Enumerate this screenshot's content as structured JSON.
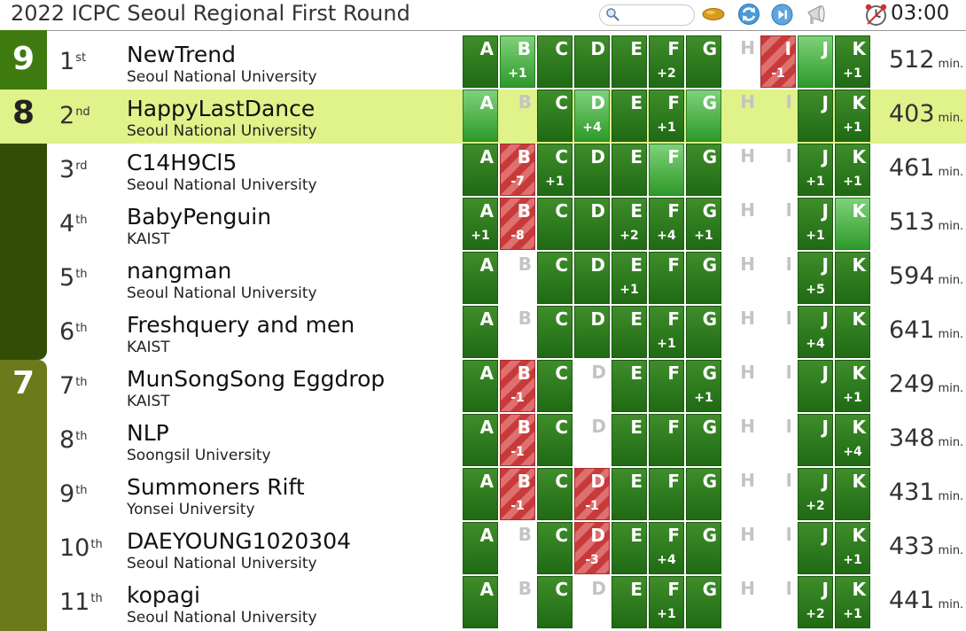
{
  "header": {
    "title": "2022 ICPC Seoul Regional First Round",
    "timer": "03:00",
    "search": {
      "placeholder": "",
      "value": ""
    },
    "icons": [
      "search-icon",
      "ball-icon",
      "refresh-icon",
      "play-icon",
      "megaphone-icon",
      "clock-icon"
    ]
  },
  "colors": {
    "solved": "#2f7d1f",
    "first_solve": "#59b851",
    "failed": "#cc4444",
    "highlight_row": "#e0f28a",
    "band_9": "#3f7a10",
    "band_8": "#e0f28a",
    "band_high": "#344d06",
    "band_7": "#6b7a1a"
  },
  "bands": [
    {
      "label": "9",
      "style": "band_9"
    },
    {
      "label": "8",
      "style": "band_8"
    },
    {
      "label": "",
      "style": "band_high"
    },
    {
      "label": "7",
      "style": "band_7"
    }
  ],
  "problems": [
    "A",
    "B",
    "C",
    "D",
    "E",
    "F",
    "G",
    "H",
    "I",
    "J",
    "K"
  ],
  "score_unit": "min.",
  "teams": [
    {
      "rank": "1",
      "suffix": "st",
      "name": "NewTrend",
      "university": "Seoul National University",
      "score": "512",
      "highlight": false,
      "cells": [
        [
          "s",
          ""
        ],
        [
          "f1",
          "+1"
        ],
        [
          "s",
          ""
        ],
        [
          "s",
          ""
        ],
        [
          "s",
          ""
        ],
        [
          "s",
          "+2"
        ],
        [
          "s",
          ""
        ],
        [
          "e",
          ""
        ],
        [
          "x",
          "-1"
        ],
        [
          "f1",
          ""
        ],
        [
          "s",
          "+1"
        ]
      ]
    },
    {
      "rank": "2",
      "suffix": "nd",
      "name": "HappyLastDance",
      "university": "Seoul National University",
      "score": "403",
      "highlight": true,
      "cells": [
        [
          "f1",
          ""
        ],
        [
          "e",
          ""
        ],
        [
          "s",
          ""
        ],
        [
          "f1",
          "+4"
        ],
        [
          "s",
          ""
        ],
        [
          "s",
          "+1"
        ],
        [
          "f1",
          ""
        ],
        [
          "e",
          ""
        ],
        [
          "e",
          ""
        ],
        [
          "s",
          ""
        ],
        [
          "s",
          "+1"
        ]
      ]
    },
    {
      "rank": "3",
      "suffix": "rd",
      "name": "C14H9Cl5",
      "university": "Seoul National University",
      "score": "461",
      "highlight": false,
      "cells": [
        [
          "s",
          ""
        ],
        [
          "x",
          "-7"
        ],
        [
          "s",
          "+1"
        ],
        [
          "s",
          ""
        ],
        [
          "s",
          ""
        ],
        [
          "f1",
          ""
        ],
        [
          "s",
          ""
        ],
        [
          "e",
          ""
        ],
        [
          "e",
          ""
        ],
        [
          "s",
          "+1"
        ],
        [
          "s",
          "+1"
        ]
      ]
    },
    {
      "rank": "4",
      "suffix": "th",
      "name": "BabyPenguin",
      "university": "KAIST",
      "score": "513",
      "highlight": false,
      "cells": [
        [
          "s",
          "+1"
        ],
        [
          "x",
          "-8"
        ],
        [
          "s",
          ""
        ],
        [
          "s",
          ""
        ],
        [
          "s",
          "+2"
        ],
        [
          "s",
          "+4"
        ],
        [
          "s",
          "+1"
        ],
        [
          "e",
          ""
        ],
        [
          "e",
          ""
        ],
        [
          "s",
          "+1"
        ],
        [
          "f1",
          ""
        ]
      ]
    },
    {
      "rank": "5",
      "suffix": "th",
      "name": "nangman",
      "university": "Seoul National University",
      "score": "594",
      "highlight": false,
      "cells": [
        [
          "s",
          ""
        ],
        [
          "e",
          ""
        ],
        [
          "s",
          ""
        ],
        [
          "s",
          ""
        ],
        [
          "s",
          "+1"
        ],
        [
          "s",
          ""
        ],
        [
          "s",
          ""
        ],
        [
          "e",
          ""
        ],
        [
          "e",
          ""
        ],
        [
          "s",
          "+5"
        ],
        [
          "s",
          ""
        ]
      ]
    },
    {
      "rank": "6",
      "suffix": "th",
      "name": "Freshquery and men",
      "university": "KAIST",
      "score": "641",
      "highlight": false,
      "cells": [
        [
          "s",
          ""
        ],
        [
          "e",
          ""
        ],
        [
          "s",
          ""
        ],
        [
          "s",
          ""
        ],
        [
          "s",
          ""
        ],
        [
          "s",
          "+1"
        ],
        [
          "s",
          ""
        ],
        [
          "e",
          ""
        ],
        [
          "e",
          ""
        ],
        [
          "s",
          "+4"
        ],
        [
          "s",
          ""
        ]
      ]
    },
    {
      "rank": "7",
      "suffix": "th",
      "name": "MunSongSong Eggdrop",
      "university": "KAIST",
      "score": "249",
      "highlight": false,
      "cells": [
        [
          "s",
          ""
        ],
        [
          "x",
          "-1"
        ],
        [
          "s",
          ""
        ],
        [
          "e",
          ""
        ],
        [
          "s",
          ""
        ],
        [
          "s",
          ""
        ],
        [
          "s",
          "+1"
        ],
        [
          "e",
          ""
        ],
        [
          "e",
          ""
        ],
        [
          "s",
          ""
        ],
        [
          "s",
          "+1"
        ]
      ]
    },
    {
      "rank": "8",
      "suffix": "th",
      "name": "NLP",
      "university": "Soongsil University",
      "score": "348",
      "highlight": false,
      "cells": [
        [
          "s",
          ""
        ],
        [
          "x",
          "-1"
        ],
        [
          "s",
          ""
        ],
        [
          "e",
          ""
        ],
        [
          "s",
          ""
        ],
        [
          "s",
          ""
        ],
        [
          "s",
          ""
        ],
        [
          "e",
          ""
        ],
        [
          "e",
          ""
        ],
        [
          "s",
          ""
        ],
        [
          "s",
          "+4"
        ]
      ]
    },
    {
      "rank": "9",
      "suffix": "th",
      "name": "Summoners Rift",
      "university": "Yonsei University",
      "score": "431",
      "highlight": false,
      "cells": [
        [
          "s",
          ""
        ],
        [
          "x",
          "-1"
        ],
        [
          "s",
          ""
        ],
        [
          "x",
          "-1"
        ],
        [
          "s",
          ""
        ],
        [
          "s",
          ""
        ],
        [
          "s",
          ""
        ],
        [
          "e",
          ""
        ],
        [
          "e",
          ""
        ],
        [
          "s",
          "+2"
        ],
        [
          "s",
          ""
        ]
      ]
    },
    {
      "rank": "10",
      "suffix": "th",
      "name": "DAEYOUNG1020304",
      "university": "Seoul National University",
      "score": "433",
      "highlight": false,
      "cells": [
        [
          "s",
          ""
        ],
        [
          "e",
          ""
        ],
        [
          "s",
          ""
        ],
        [
          "x",
          "-3"
        ],
        [
          "s",
          ""
        ],
        [
          "s",
          "+4"
        ],
        [
          "s",
          ""
        ],
        [
          "e",
          ""
        ],
        [
          "e",
          ""
        ],
        [
          "s",
          ""
        ],
        [
          "s",
          "+1"
        ]
      ]
    },
    {
      "rank": "11",
      "suffix": "th",
      "name": "kopagi",
      "university": "Seoul National University",
      "score": "441",
      "highlight": false,
      "cells": [
        [
          "s",
          ""
        ],
        [
          "e",
          ""
        ],
        [
          "s",
          ""
        ],
        [
          "e",
          ""
        ],
        [
          "s",
          ""
        ],
        [
          "s",
          "+1"
        ],
        [
          "s",
          ""
        ],
        [
          "e",
          ""
        ],
        [
          "e",
          ""
        ],
        [
          "s",
          "+2"
        ],
        [
          "s",
          "+1"
        ]
      ]
    }
  ]
}
